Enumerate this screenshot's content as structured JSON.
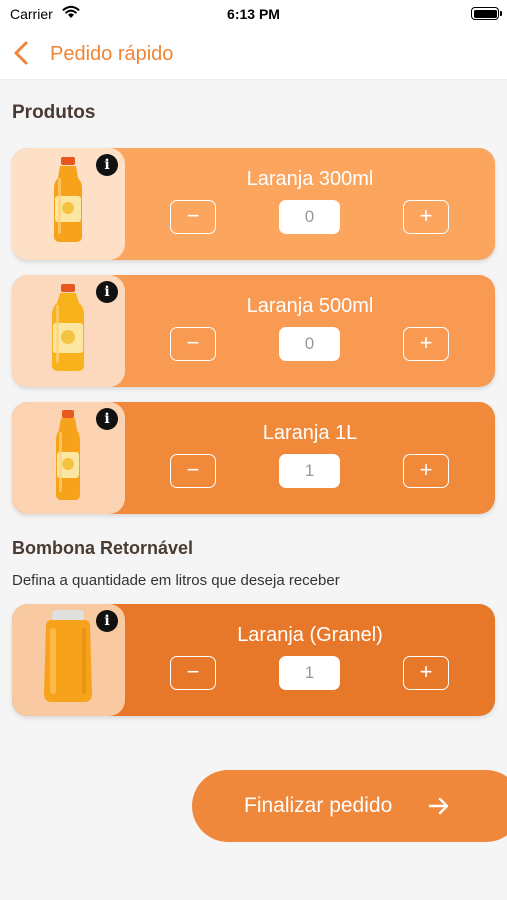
{
  "status_bar": {
    "carrier": "Carrier",
    "time": "6:13 PM"
  },
  "nav": {
    "title": "Pedido rápido"
  },
  "products_section": {
    "title": "Produtos"
  },
  "products": [
    {
      "name": "Laranja 300ml",
      "quantity": "0",
      "color": "#fba55e"
    },
    {
      "name": "Laranja 500ml",
      "quantity": "0",
      "color": "#f89a52"
    },
    {
      "name": "Laranja 1L",
      "quantity": "1",
      "color": "#f0893a"
    }
  ],
  "returnable_section": {
    "title": "Bombona Retornável",
    "subtitle": "Defina a quantidade em litros que deseja receber",
    "product": {
      "name": "Laranja (Granel)",
      "quantity": "1",
      "color": "#e7782a"
    }
  },
  "controls": {
    "minus": "−",
    "plus": "+",
    "info": "i"
  },
  "checkout": {
    "label": "Finalizar pedido"
  },
  "colors": {
    "accent": "#ef8436",
    "dark_text": "#4a3b32"
  }
}
